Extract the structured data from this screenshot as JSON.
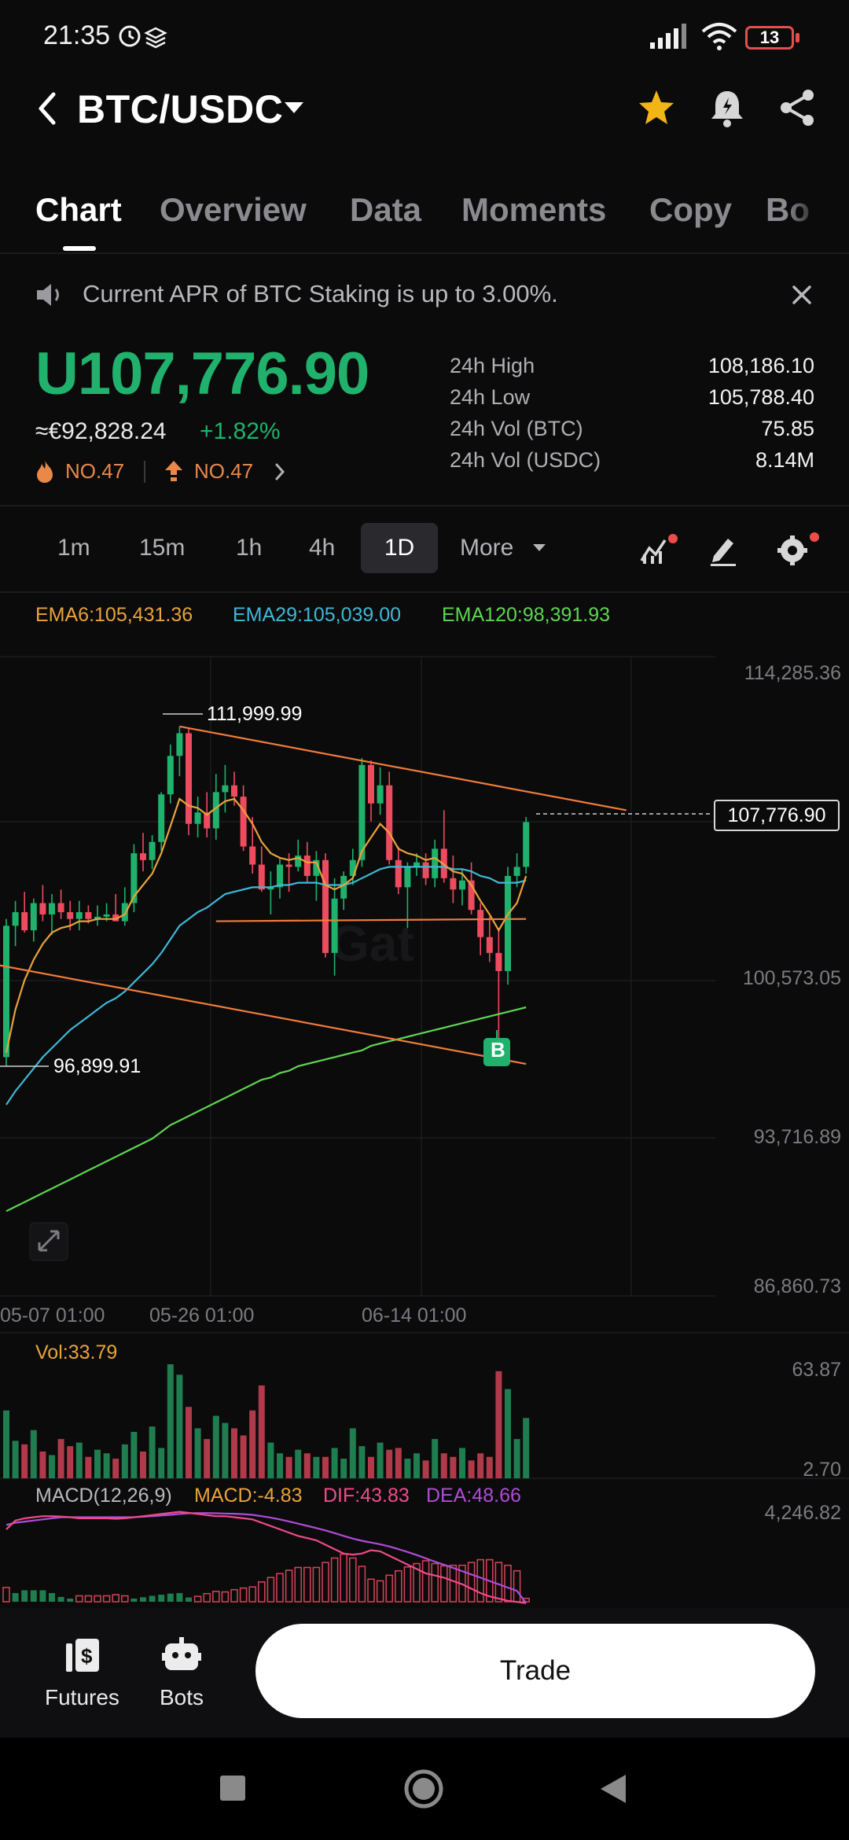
{
  "status_bar": {
    "time": "21:35",
    "battery": "13"
  },
  "header": {
    "pair": "BTC/USDC"
  },
  "tabs": [
    "Chart",
    "Overview",
    "Data",
    "Moments",
    "Copy",
    "Bot"
  ],
  "announcement": {
    "text": "Current APR of BTC Staking is up to 3.00%."
  },
  "ticker": {
    "price": "U107,776.90",
    "fiat": "≈€92,828.24",
    "change": "+1.82%",
    "rank_hot": "NO.47",
    "rank_gain": "NO.47",
    "stats": [
      {
        "label": "24h High",
        "value": "108,186.10"
      },
      {
        "label": "24h Low",
        "value": "105,788.40"
      },
      {
        "label": "24h Vol (BTC)",
        "value": "75.85"
      },
      {
        "label": "24h Vol (USDC)",
        "value": "8.14M"
      }
    ]
  },
  "intervals": [
    "1m",
    "15m",
    "1h",
    "4h",
    "1D",
    "More"
  ],
  "active_interval": "1D",
  "indicators": {
    "ema6": "EMA6:105,431.36",
    "ema29": "EMA29:105,039.00",
    "ema120": "EMA120:98,391.93",
    "vol": "Vol:33.79",
    "macd_title": "MACD(12,26,9)",
    "macd": "MACD:-4.83",
    "dif": "DIF:43.83",
    "dea": "DEA:48.66"
  },
  "chart": {
    "y_labels": [
      "114,285.36",
      "100,573.05",
      "93,716.89",
      "86,860.73"
    ],
    "x_labels": [
      "05-07 01:00",
      "05-26 01:00",
      "06-14 01:00"
    ],
    "high_marker": "111,999.99",
    "low_marker": "96,899.91",
    "last_price": "107,776.90",
    "buy_marker": "B",
    "vol_axis": [
      "63.87",
      "2.70"
    ],
    "macd_axis": "4,246.82"
  },
  "colors": {
    "up": "#20b26c",
    "down": "#ef4b5f",
    "ema6": "#e8a33a",
    "ema29": "#3fb8d6",
    "ema120": "#5ed651",
    "trendline": "#f07c3a"
  },
  "chart_data": {
    "type": "candlestick",
    "candles": [
      {
        "o": 97400,
        "h": 103500,
        "l": 97000,
        "c": 103200
      },
      {
        "o": 103200,
        "h": 104300,
        "l": 102300,
        "c": 103800
      },
      {
        "o": 103800,
        "h": 104700,
        "l": 102900,
        "c": 103000
      },
      {
        "o": 103000,
        "h": 104400,
        "l": 102500,
        "c": 104200
      },
      {
        "o": 104200,
        "h": 105000,
        "l": 103400,
        "c": 103700
      },
      {
        "o": 103700,
        "h": 104600,
        "l": 102800,
        "c": 104200
      },
      {
        "o": 104200,
        "h": 104800,
        "l": 103500,
        "c": 103800
      },
      {
        "o": 103800,
        "h": 104300,
        "l": 103000,
        "c": 103500
      },
      {
        "o": 103500,
        "h": 104300,
        "l": 103000,
        "c": 103800
      },
      {
        "o": 103800,
        "h": 104100,
        "l": 103300,
        "c": 103500
      },
      {
        "o": 103500,
        "h": 104100,
        "l": 103200,
        "c": 103600
      },
      {
        "o": 103600,
        "h": 104200,
        "l": 103400,
        "c": 103700
      },
      {
        "o": 103700,
        "h": 104600,
        "l": 103500,
        "c": 103400
      },
      {
        "o": 103400,
        "h": 104900,
        "l": 103200,
        "c": 104200
      },
      {
        "o": 104200,
        "h": 106800,
        "l": 103800,
        "c": 106400
      },
      {
        "o": 106400,
        "h": 107300,
        "l": 105600,
        "c": 106100
      },
      {
        "o": 106100,
        "h": 107200,
        "l": 105700,
        "c": 106900
      },
      {
        "o": 106900,
        "h": 109100,
        "l": 106500,
        "c": 109000
      },
      {
        "o": 109000,
        "h": 111200,
        "l": 108600,
        "c": 110700
      },
      {
        "o": 110700,
        "h": 112000,
        "l": 109800,
        "c": 111700
      },
      {
        "o": 111700,
        "h": 111900,
        "l": 107200,
        "c": 107700
      },
      {
        "o": 107700,
        "h": 108900,
        "l": 107100,
        "c": 108200
      },
      {
        "o": 108200,
        "h": 109100,
        "l": 107100,
        "c": 107500
      },
      {
        "o": 107500,
        "h": 109900,
        "l": 107000,
        "c": 109100
      },
      {
        "o": 109100,
        "h": 110300,
        "l": 108200,
        "c": 109400
      },
      {
        "o": 109400,
        "h": 110000,
        "l": 108500,
        "c": 108900
      },
      {
        "o": 108900,
        "h": 109400,
        "l": 106500,
        "c": 106700
      },
      {
        "o": 106700,
        "h": 108000,
        "l": 105500,
        "c": 105900
      },
      {
        "o": 105900,
        "h": 106700,
        "l": 104700,
        "c": 104800
      },
      {
        "o": 104800,
        "h": 105600,
        "l": 103700,
        "c": 104900
      },
      {
        "o": 104900,
        "h": 106200,
        "l": 104400,
        "c": 105900
      },
      {
        "o": 105900,
        "h": 106400,
        "l": 104700,
        "c": 105800
      },
      {
        "o": 105800,
        "h": 107000,
        "l": 105600,
        "c": 106300
      },
      {
        "o": 106300,
        "h": 106900,
        "l": 105100,
        "c": 105400
      },
      {
        "o": 105400,
        "h": 106500,
        "l": 104300,
        "c": 106100
      },
      {
        "o": 106100,
        "h": 106400,
        "l": 101800,
        "c": 102000
      },
      {
        "o": 102000,
        "h": 105300,
        "l": 101000,
        "c": 104400
      },
      {
        "o": 104400,
        "h": 105600,
        "l": 103900,
        "c": 105400
      },
      {
        "o": 105400,
        "h": 106600,
        "l": 105000,
        "c": 106100
      },
      {
        "o": 106100,
        "h": 110600,
        "l": 105800,
        "c": 110300
      },
      {
        "o": 110300,
        "h": 110500,
        "l": 107800,
        "c": 108600
      },
      {
        "o": 108600,
        "h": 110200,
        "l": 108100,
        "c": 109400
      },
      {
        "o": 109400,
        "h": 110000,
        "l": 105900,
        "c": 106100
      },
      {
        "o": 106100,
        "h": 106700,
        "l": 104600,
        "c": 104900
      },
      {
        "o": 104900,
        "h": 106000,
        "l": 103100,
        "c": 105800
      },
      {
        "o": 105800,
        "h": 106400,
        "l": 105400,
        "c": 106000
      },
      {
        "o": 106000,
        "h": 106400,
        "l": 105000,
        "c": 105300
      },
      {
        "o": 105300,
        "h": 107000,
        "l": 104900,
        "c": 106600
      },
      {
        "o": 106600,
        "h": 108300,
        "l": 105100,
        "c": 105300
      },
      {
        "o": 105300,
        "h": 106300,
        "l": 104200,
        "c": 104800
      },
      {
        "o": 104800,
        "h": 105700,
        "l": 104100,
        "c": 105200
      },
      {
        "o": 105200,
        "h": 106000,
        "l": 103700,
        "c": 103900
      },
      {
        "o": 103900,
        "h": 104200,
        "l": 101900,
        "c": 102700
      },
      {
        "o": 102700,
        "h": 103600,
        "l": 101600,
        "c": 102000
      },
      {
        "o": 102000,
        "h": 103100,
        "l": 97900,
        "c": 101200
      },
      {
        "o": 101200,
        "h": 105800,
        "l": 100600,
        "c": 105400
      },
      {
        "o": 105400,
        "h": 106400,
        "l": 104900,
        "c": 105800
      },
      {
        "o": 105800,
        "h": 108000,
        "l": 105500,
        "c": 107777
      }
    ],
    "ema6": [
      97600,
      99500,
      100800,
      101700,
      102400,
      102900,
      103100,
      103200,
      103400,
      103400,
      103500,
      103500,
      103500,
      103700,
      104500,
      105000,
      105500,
      106400,
      107600,
      108800,
      108500,
      108400,
      108100,
      108400,
      108700,
      108800,
      108300,
      107700,
      106900,
      106400,
      106200,
      106100,
      106200,
      106000,
      106000,
      105000,
      104800,
      105000,
      105300,
      106500,
      107100,
      107700,
      107300,
      106600,
      106400,
      106300,
      106100,
      106200,
      105900,
      105600,
      105500,
      105000,
      104300,
      103700,
      103000,
      103700,
      104200,
      105400
    ],
    "ema29": [
      95300,
      95900,
      96400,
      96900,
      97400,
      97800,
      98200,
      98600,
      98900,
      99200,
      99500,
      99800,
      100000,
      100300,
      100700,
      101100,
      101500,
      102000,
      102600,
      103200,
      103500,
      103800,
      104000,
      104300,
      104600,
      104700,
      104800,
      104900,
      104900,
      104900,
      105000,
      105000,
      105100,
      105100,
      105100,
      105000,
      105000,
      105000,
      105100,
      105300,
      105500,
      105700,
      105800,
      105800,
      105800,
      105800,
      105800,
      105800,
      105800,
      105700,
      105700,
      105600,
      105400,
      105300,
      105100,
      105100,
      105100,
      105200
    ],
    "ema120": [
      90600,
      90800,
      91000,
      91200,
      91400,
      91600,
      91800,
      92000,
      92200,
      92400,
      92600,
      92800,
      93000,
      93200,
      93400,
      93600,
      93800,
      94100,
      94400,
      94600,
      94800,
      95000,
      95200,
      95400,
      95600,
      95800,
      96000,
      96200,
      96400,
      96500,
      96700,
      96800,
      97000,
      97100,
      97200,
      97300,
      97400,
      97500,
      97600,
      97700,
      97900,
      98000,
      98100,
      98200,
      98300,
      98400,
      98500,
      98600,
      98700,
      98800,
      98900,
      99000,
      99100,
      99200,
      99300,
      99400,
      99500,
      99600
    ],
    "volumes": [
      38,
      21,
      19,
      27,
      15,
      13,
      22,
      18,
      20,
      12,
      16,
      14,
      11,
      19,
      26,
      15,
      29,
      17,
      63.87,
      58,
      40,
      28,
      22,
      35,
      31,
      28,
      24,
      38,
      52,
      20,
      14,
      12,
      16,
      14,
      12,
      12,
      17,
      11,
      28,
      18,
      12,
      20,
      16,
      17,
      11,
      14,
      10,
      22,
      14,
      12,
      17,
      10,
      14,
      12,
      60,
      50,
      22,
      33.79
    ],
    "macd_dif": [
      3400,
      3800,
      3900,
      3950,
      4000,
      4000,
      3980,
      3950,
      3900,
      3900,
      3900,
      3900,
      3880,
      3900,
      3950,
      4000,
      4050,
      4100,
      4150,
      4200,
      4150,
      4100,
      4050,
      4000,
      4000,
      3950,
      3900,
      3850,
      3700,
      3550,
      3400,
      3250,
      3100,
      3000,
      2900,
      2700,
      2500,
      2300,
      2250,
      2300,
      2450,
      2400,
      2200,
      2000,
      1800,
      1600,
      1400,
      1300,
      1200,
      1050,
      900,
      700,
      500,
      350,
      250,
      150,
      100,
      43.83
    ],
    "macd_dea": [
      3600,
      3700,
      3750,
      3800,
      3850,
      3900,
      3950,
      3950,
      3950,
      3950,
      3950,
      3950,
      3950,
      3950,
      3950,
      3975,
      4000,
      4030,
      4060,
      4100,
      4130,
      4140,
      4140,
      4130,
      4120,
      4110,
      4090,
      4060,
      4000,
      3930,
      3850,
      3760,
      3660,
      3560,
      3460,
      3350,
      3230,
      3100,
      2980,
      2880,
      2800,
      2720,
      2620,
      2500,
      2370,
      2230,
      2080,
      1930,
      1790,
      1650,
      1500,
      1350,
      1200,
      1050,
      900,
      750,
      600,
      48.66
    ],
    "y_range": [
      86860.73,
      114285.36
    ],
    "trendlines": [
      {
        "from": [
          19,
          111999.99
        ],
        "to": [
          68,
          108300
        ]
      },
      {
        "from": [
          -4,
          101700
        ],
        "to": [
          57,
          97100
        ]
      },
      {
        "from": [
          23,
          103400
        ],
        "to": [
          57,
          103500
        ]
      }
    ]
  }
}
